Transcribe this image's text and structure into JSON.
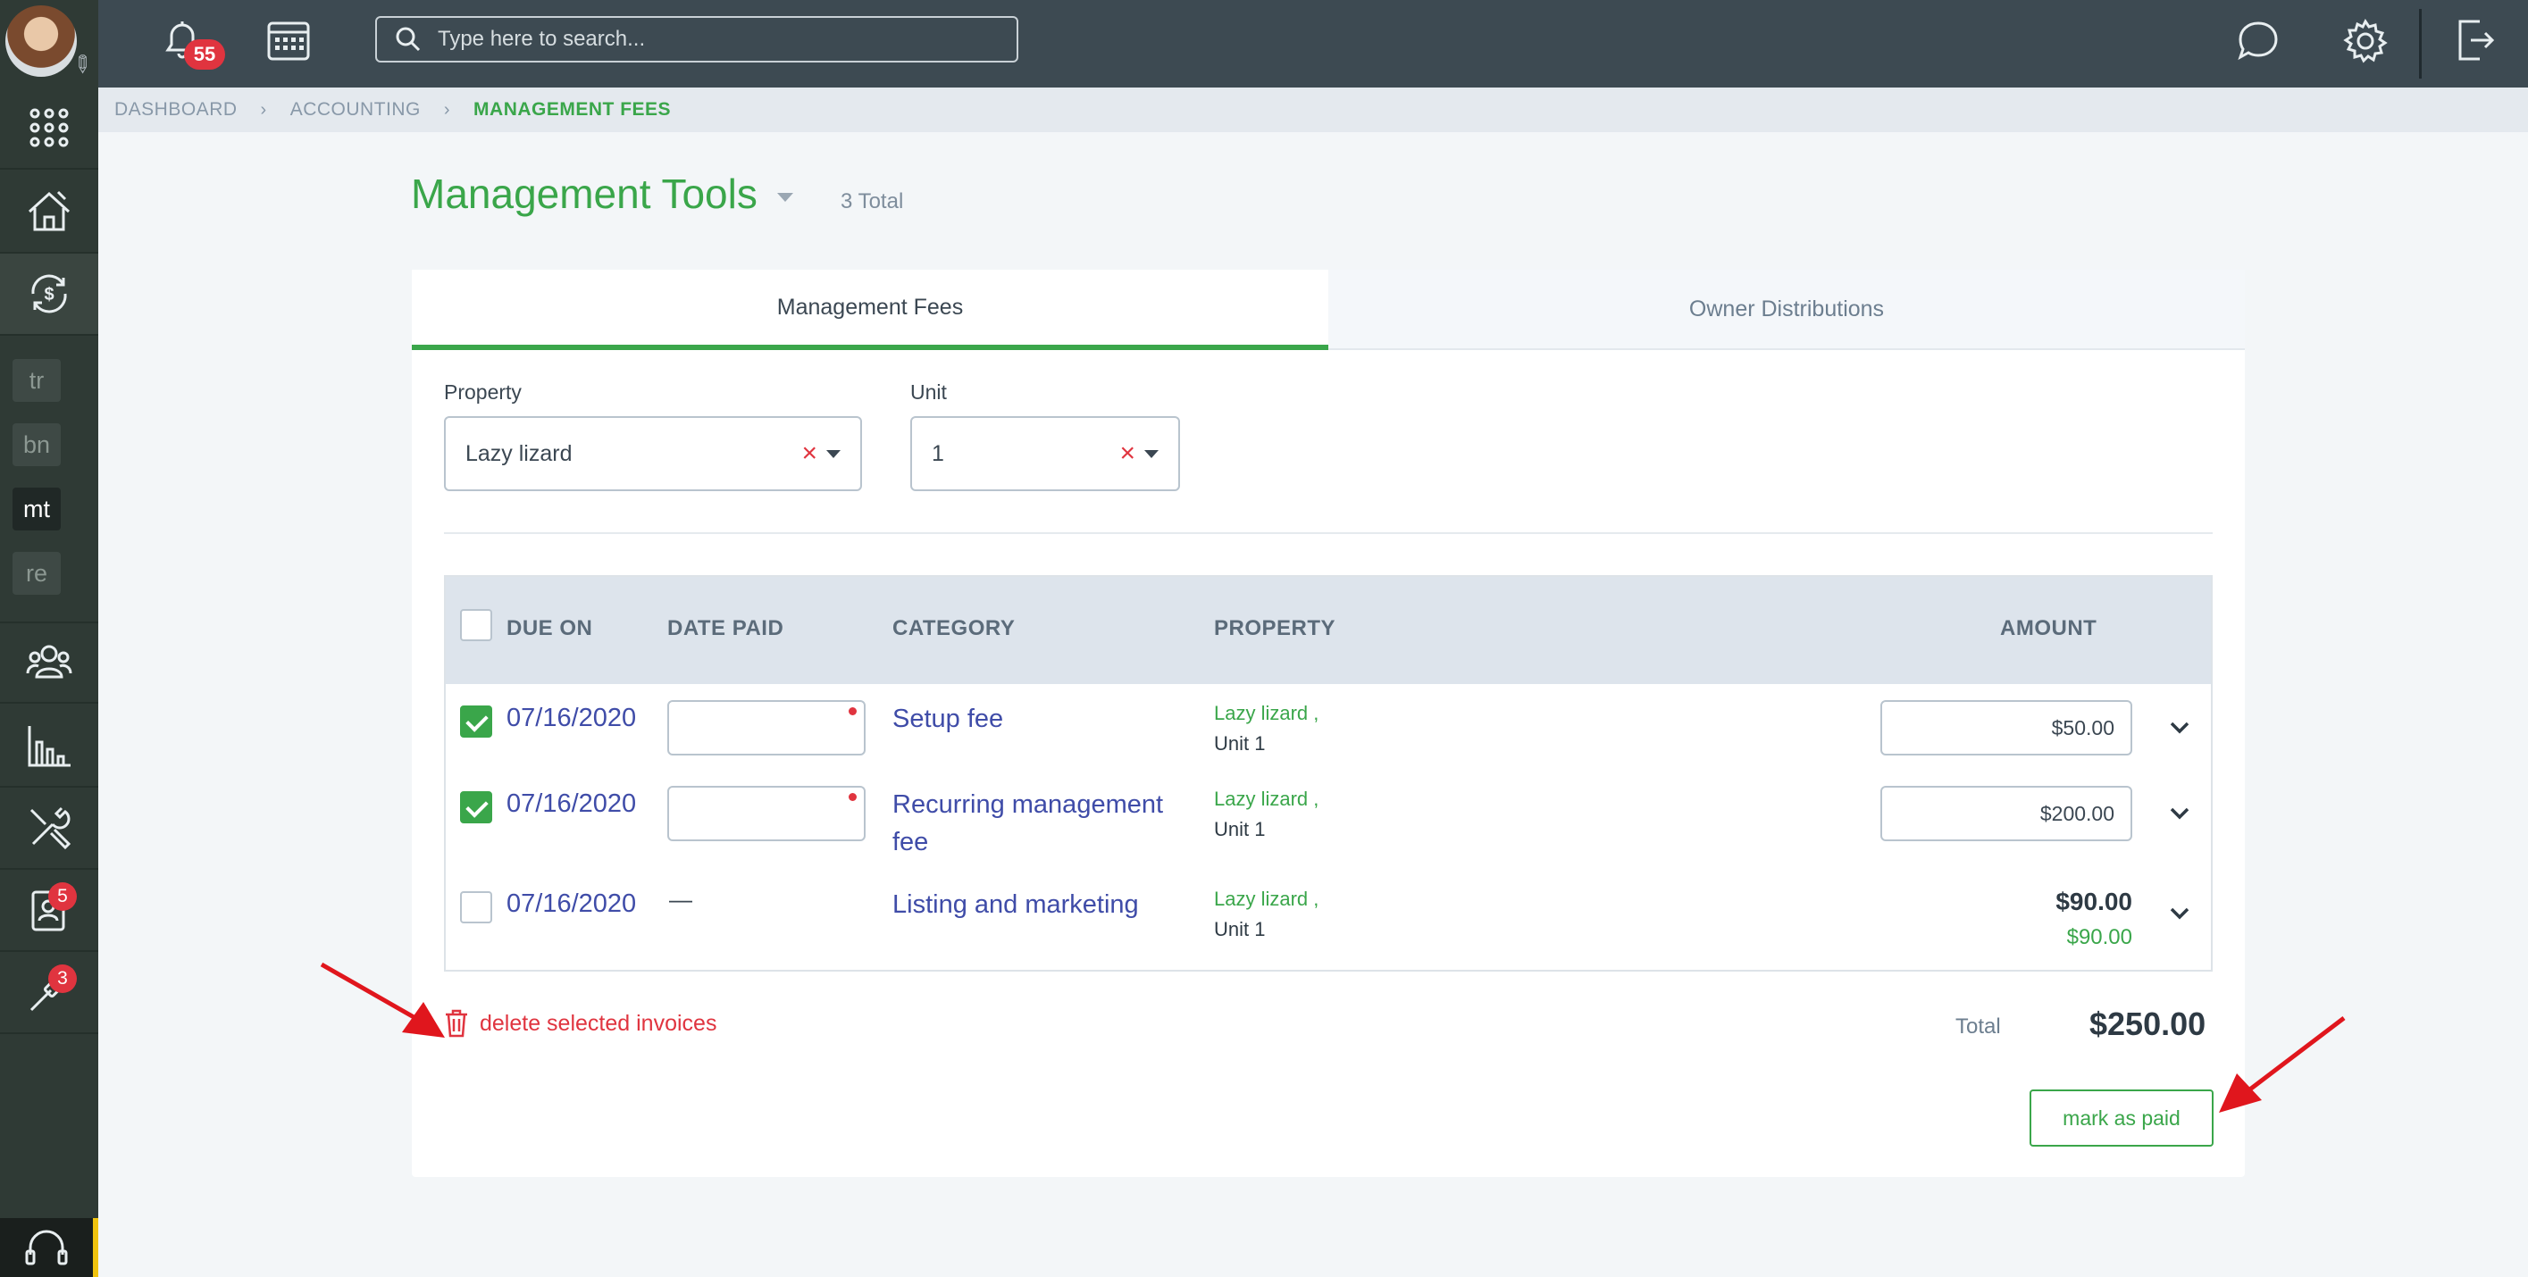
{
  "header": {
    "search_placeholder": "Type here to search...",
    "notification_count": "55"
  },
  "sidebar": {
    "shortcuts": [
      "tr",
      "bn",
      "mt",
      "re"
    ],
    "badges": {
      "contacts": "5",
      "maintenance": "3"
    }
  },
  "breadcrumb": {
    "items": [
      "DASHBOARD",
      "ACCOUNTING",
      "MANAGEMENT FEES"
    ]
  },
  "page": {
    "title": "Management Tools",
    "total": "3 Total"
  },
  "tabs": [
    "Management Fees",
    "Owner Distributions"
  ],
  "filters": {
    "property_label": "Property",
    "property_value": "Lazy lizard",
    "unit_label": "Unit",
    "unit_value": "1"
  },
  "table": {
    "columns": [
      "DUE ON",
      "DATE PAID",
      "CATEGORY",
      "PROPERTY",
      "AMOUNT"
    ],
    "rows": [
      {
        "checked": true,
        "due_on": "07/16/2020",
        "category": [
          "Setup fee"
        ],
        "property": "Lazy lizard ,",
        "unit": "Unit 1",
        "amount": "$50.00"
      },
      {
        "checked": true,
        "due_on": "07/16/2020",
        "category": [
          "Recurring management",
          "fee"
        ],
        "property": "Lazy lizard ,",
        "unit": "Unit 1",
        "amount": "$200.00"
      },
      {
        "checked": false,
        "due_on": "07/16/2020",
        "date_paid": "—",
        "category": [
          "Listing and marketing"
        ],
        "property": "Lazy lizard ,",
        "unit": "Unit 1",
        "amount": "$90.00",
        "amount_paid": "$90.00"
      }
    ]
  },
  "footer": {
    "delete_label": "delete selected invoices",
    "total_label": "Total",
    "total_value": "$250.00",
    "mark_paid_label": "mark as paid"
  },
  "colors": {
    "accent": "#3aa64a",
    "link": "#3f4ca8",
    "danger": "#e0343f",
    "topbar": "#3d4a52",
    "sidebar": "#2f3a35"
  }
}
